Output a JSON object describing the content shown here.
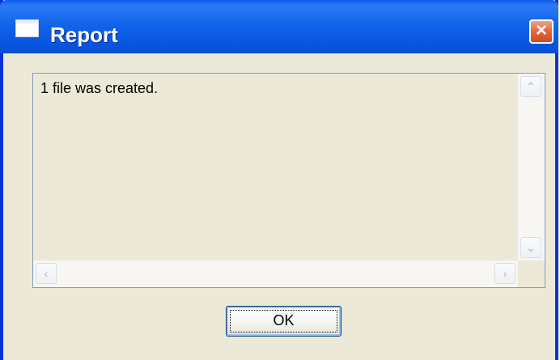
{
  "window": {
    "title": "Report"
  },
  "report": {
    "text": "1 file was created."
  },
  "buttons": {
    "ok_label": "OK"
  },
  "icons": {
    "close": "×",
    "scroll_up": "⌃",
    "scroll_down": "⌄",
    "scroll_left": "‹",
    "scroll_right": "›"
  },
  "colors": {
    "titlebar": "#0a5ae8",
    "dialog_bg": "#ece9d8",
    "close": "#d24a24"
  }
}
